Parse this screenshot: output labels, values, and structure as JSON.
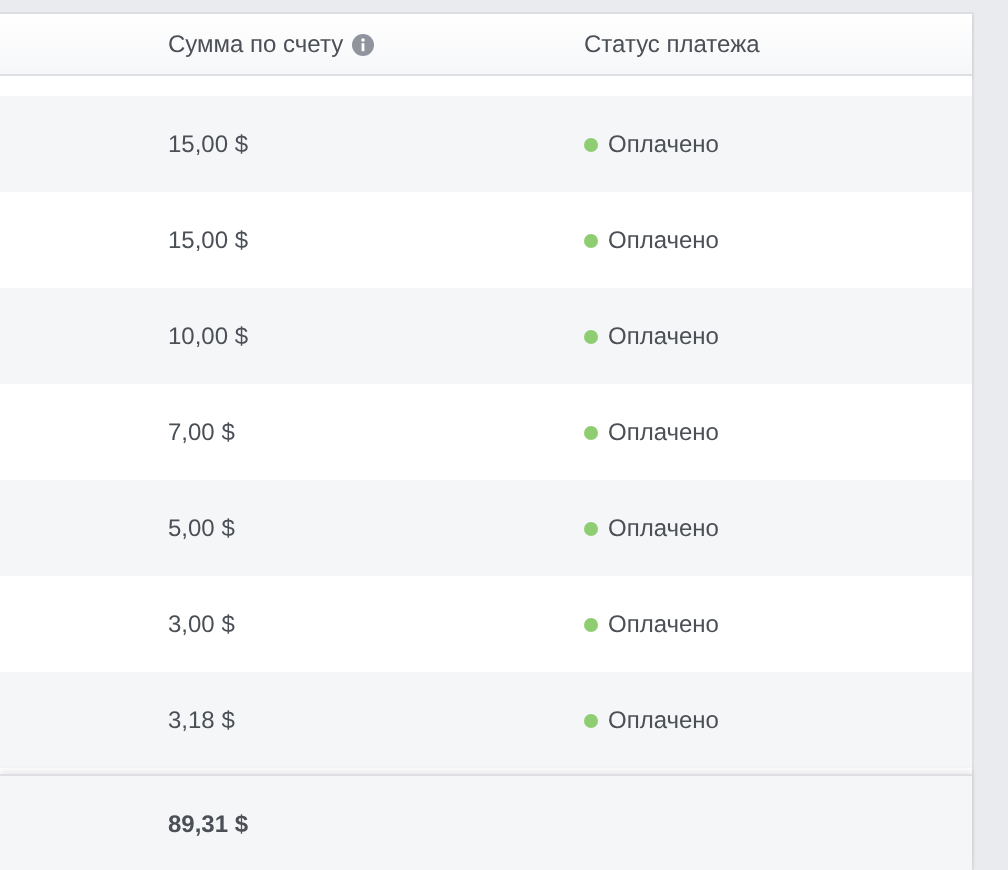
{
  "table": {
    "columns": [
      {
        "label": "Сумма по счету",
        "info": true
      },
      {
        "label": "Статус платежа",
        "info": false
      }
    ],
    "rows": [
      {
        "amount": "15,00 $",
        "status": "Оплачено",
        "color": "#8fcd73"
      },
      {
        "amount": "15,00 $",
        "status": "Оплачено",
        "color": "#8fcd73"
      },
      {
        "amount": "10,00 $",
        "status": "Оплачено",
        "color": "#8fcd73"
      },
      {
        "amount": "7,00 $",
        "status": "Оплачено",
        "color": "#8fcd73"
      },
      {
        "amount": "5,00 $",
        "status": "Оплачено",
        "color": "#8fcd73"
      },
      {
        "amount": "3,00 $",
        "status": "Оплачено",
        "color": "#8fcd73"
      },
      {
        "amount": "3,18 $",
        "status": "Оплачено",
        "color": "#8fcd73"
      }
    ],
    "total": "89,31 $"
  }
}
